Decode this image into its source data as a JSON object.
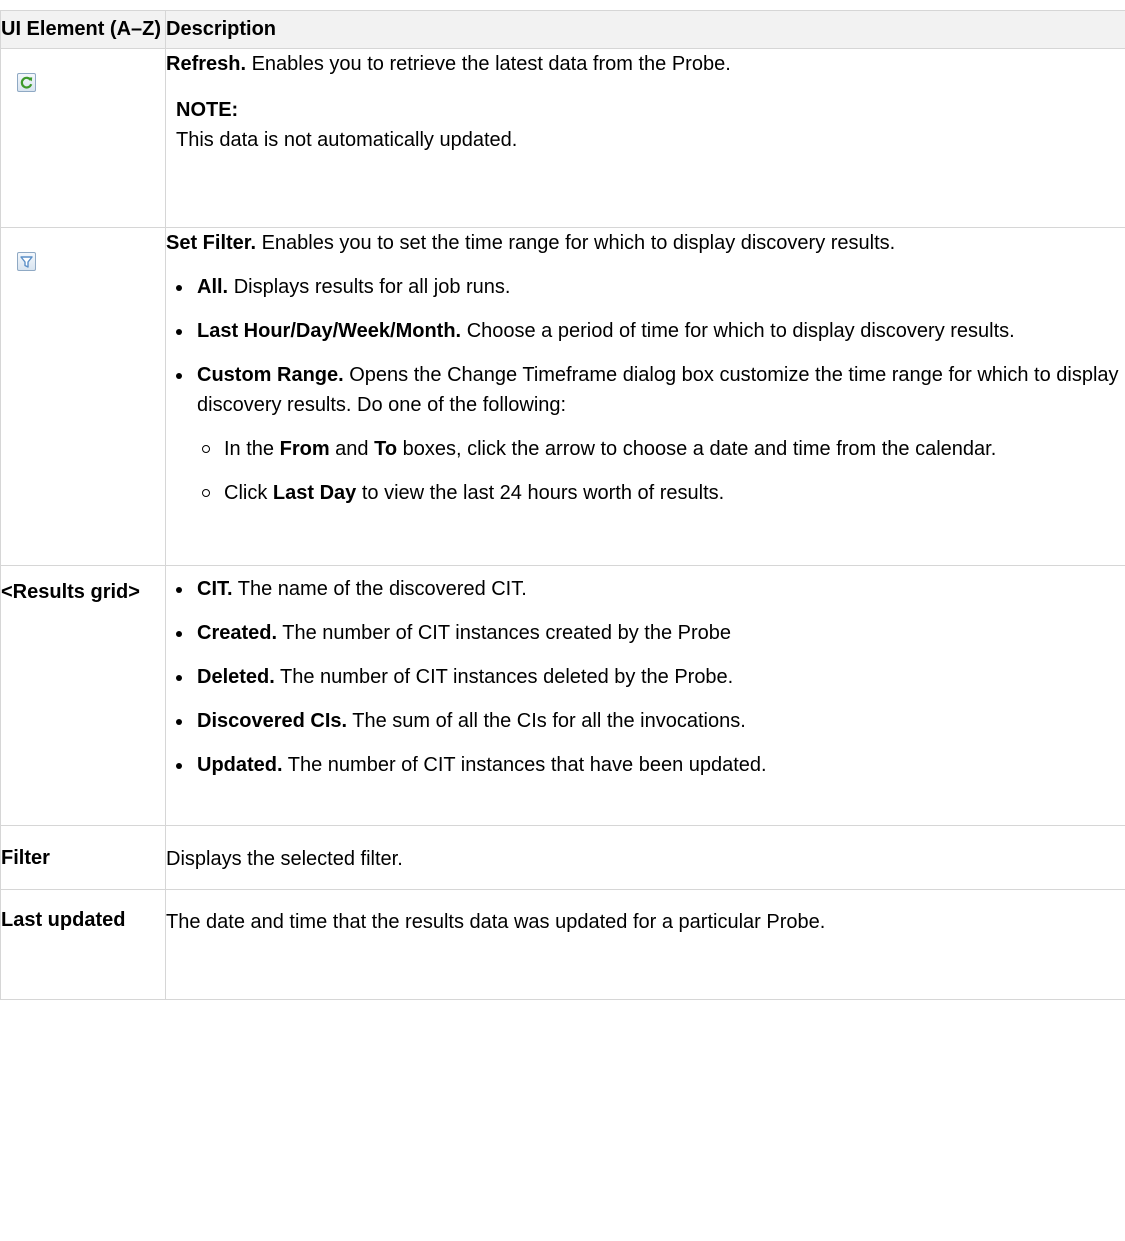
{
  "table": {
    "header": {
      "col1": "UI Element (A–Z)",
      "col2": "Description"
    },
    "rows": {
      "refresh": {
        "icon": "refresh-icon",
        "title": "Refresh.",
        "text": "Enables you to retrieve the latest data from the Probe.",
        "note_title": "NOTE:",
        "note_text": "This data is not automatically updated."
      },
      "set_filter": {
        "icon": "filter-icon",
        "title": "Set Filter.",
        "text": "Enables you to set the time range for which to display discovery results.",
        "bullets": {
          "all": {
            "title": "All.",
            "text": "Displays results for all job runs."
          },
          "last": {
            "title": "Last Hour/Day/Week/Month.",
            "text": "Choose a period of time for which to display discovery results."
          },
          "custom": {
            "title": "Custom Range.",
            "text": "Opens the Change Timeframe dialog box customize the time range for which to display discovery results. Do one of the following:"
          }
        },
        "sub": {
          "s1_a": "In the",
          "s1_from": "From",
          "s1_and": "and",
          "s1_to": "To",
          "s1_b": "boxes, click the arrow to choose a date and time from the calendar.",
          "s2_a": "Click",
          "s2_bold": "Last Day",
          "s2_b": "to view the last 24 hours worth of results."
        }
      },
      "results_grid": {
        "name": "<Results grid>",
        "items": {
          "cit": {
            "title": "CIT.",
            "text": "The name of the discovered CIT."
          },
          "created": {
            "title": "Created.",
            "text": "The number of CIT instances created by the Probe"
          },
          "deleted": {
            "title": "Deleted.",
            "text": "The number of CIT instances deleted by the Probe."
          },
          "discovered": {
            "title": "Discovered CIs.",
            "text": "The sum of all the CIs for all the invocations."
          },
          "updated": {
            "title": "Updated.",
            "text": "The number of CIT instances that have been updated."
          }
        }
      },
      "filter": {
        "name": "Filter",
        "text": "Displays the selected filter."
      },
      "last_updated": {
        "name": "Last updated",
        "text": "The date and time that the results data was updated for a particular Probe."
      }
    }
  },
  "colors": {
    "border": "#d6d6d6",
    "header_bg": "#f2f2f2",
    "refresh_green": "#3e9a2c",
    "filter_blue": "#5b8fc7"
  }
}
